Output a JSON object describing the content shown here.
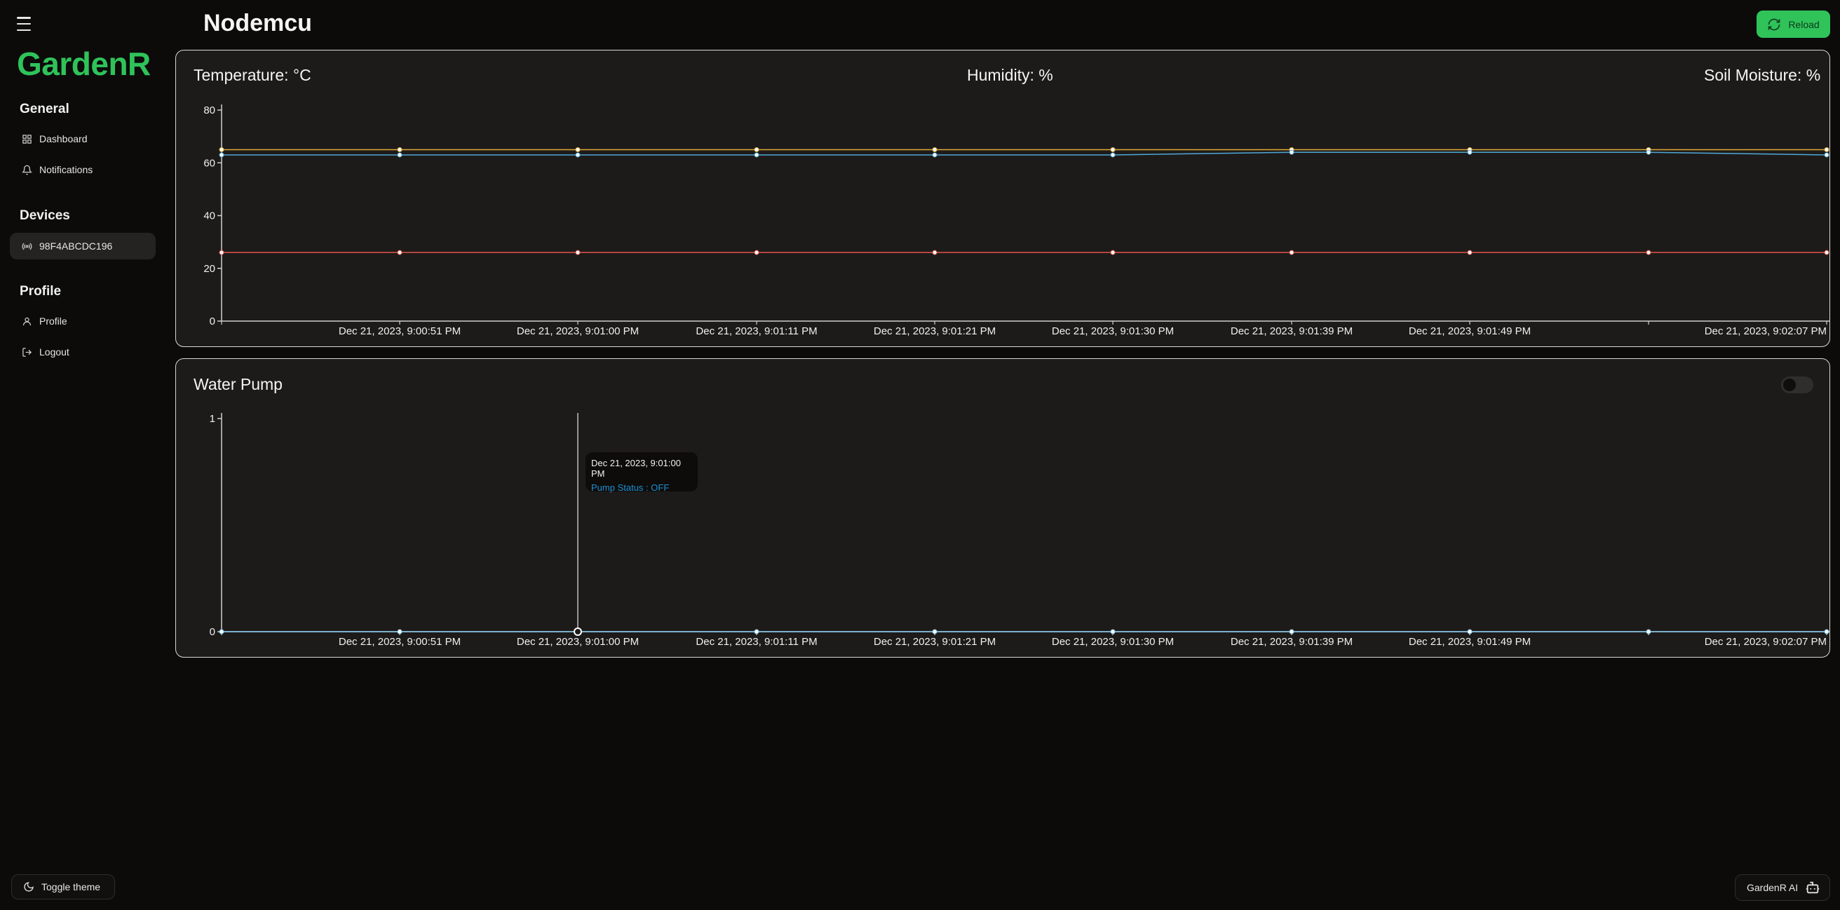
{
  "sidebar": {
    "logo": "GardenR",
    "sections": [
      {
        "title": "General"
      },
      {
        "title": "Devices"
      },
      {
        "title": "Profile"
      }
    ],
    "items": [
      {
        "label": "Dashboard",
        "icon": "dashboard-icon"
      },
      {
        "label": "Notifications",
        "icon": "bell-icon"
      },
      {
        "label": "98F4ABCDC196",
        "icon": "broadcast-icon",
        "active": true
      },
      {
        "label": "Profile",
        "icon": "user-icon"
      },
      {
        "label": "Logout",
        "icon": "logout-icon"
      }
    ],
    "toggle_theme": "Toggle theme"
  },
  "header": {
    "title": "Nodemcu",
    "reload_label": "Reload"
  },
  "sensor_card": {
    "temperature_label": "Temperature: °C",
    "humidity_label": "Humidity: %",
    "soil_label": "Soil Moisture: %"
  },
  "pump_card": {
    "title": "Water Pump",
    "tooltip_time": "Dec 21, 2023, 9:01:00 PM",
    "tooltip_status": "Pump Status : OFF"
  },
  "ai_button": "GardenR AI",
  "colors": {
    "accent": "#2fc35a",
    "temperature": "#e4554e",
    "humidity": "#e0a938",
    "soil": "#4fa8d8",
    "pump": "#7fc4ea"
  },
  "chart_data": [
    {
      "type": "line",
      "categories": [
        "",
        "Dec 21, 2023, 9:00:51 PM",
        "Dec 21, 2023, 9:01:00 PM",
        "Dec 21, 2023, 9:01:11 PM",
        "Dec 21, 2023, 9:01:21 PM",
        "Dec 21, 2023, 9:01:30 PM",
        "Dec 21, 2023, 9:01:39 PM",
        "Dec 21, 2023, 9:01:49 PM",
        "",
        "Dec 21, 2023, 9:02:07 PM"
      ],
      "series": [
        {
          "values": [
            26,
            26,
            26,
            26,
            26,
            26,
            26,
            26,
            26,
            26
          ],
          "color": "#e4554e"
        },
        {
          "values": [
            65,
            65,
            65,
            65,
            65,
            65,
            65,
            65,
            65,
            65
          ],
          "color": "#e0a938"
        },
        {
          "values": [
            63,
            63,
            63,
            63,
            63,
            63,
            64,
            64,
            64,
            63
          ],
          "color": "#4fa8d8"
        }
      ],
      "yticks": [
        0,
        20,
        40,
        60,
        80
      ],
      "ylim": [
        0,
        80
      ],
      "grid": false
    },
    {
      "type": "line",
      "categories": [
        "",
        "Dec 21, 2023, 9:00:51 PM",
        "Dec 21, 2023, 9:01:00 PM",
        "Dec 21, 2023, 9:01:11 PM",
        "Dec 21, 2023, 9:01:21 PM",
        "Dec 21, 2023, 9:01:30 PM",
        "Dec 21, 2023, 9:01:39 PM",
        "Dec 21, 2023, 9:01:49 PM",
        "",
        "Dec 21, 2023, 9:02:07 PM"
      ],
      "series": [
        {
          "values": [
            0,
            0,
            0,
            0,
            0,
            0,
            0,
            0,
            0,
            0
          ],
          "color": "#7fc4ea"
        }
      ],
      "yticks": [
        0,
        1
      ],
      "ylim": [
        0,
        1
      ],
      "highlight_index": 2,
      "grid": false
    }
  ]
}
